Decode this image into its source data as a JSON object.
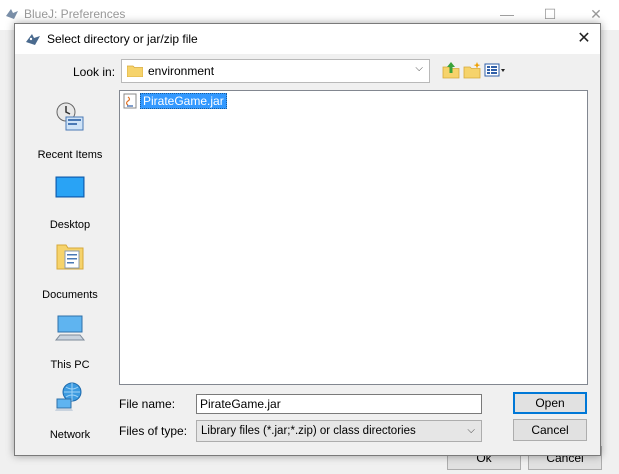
{
  "background_window": {
    "title": "BlueJ: Preferences",
    "controls": {
      "minimize": "—",
      "maximize": "☐",
      "close": "✕"
    },
    "ok_label": "Ok",
    "cancel_label": "Cancel"
  },
  "dialog": {
    "title": "Select directory or jar/zip file",
    "close_glyph": "✕",
    "look_in_label": "Look in:",
    "look_in_value": "environment",
    "chevron": "⌵",
    "places": [
      {
        "label": "Recent Items",
        "icon": "recent-items-icon"
      },
      {
        "label": "Desktop",
        "icon": "desktop-icon"
      },
      {
        "label": "Documents",
        "icon": "documents-icon"
      },
      {
        "label": "This PC",
        "icon": "this-pc-icon"
      },
      {
        "label": "Network",
        "icon": "network-icon"
      }
    ],
    "files": [
      {
        "name": "PirateGame.jar",
        "icon": "jar-file-icon",
        "selected": true
      }
    ],
    "file_name_label": "File name:",
    "file_name_value": "PirateGame.jar",
    "files_of_type_label": "Files of type:",
    "files_of_type_value": "Library files (*.jar;*.zip) or class directories",
    "open_label": "Open",
    "cancel_label": "Cancel"
  },
  "colors": {
    "selection": "#3399ff",
    "accent": "#0078d7",
    "window_bg": "#f0f0f0"
  }
}
